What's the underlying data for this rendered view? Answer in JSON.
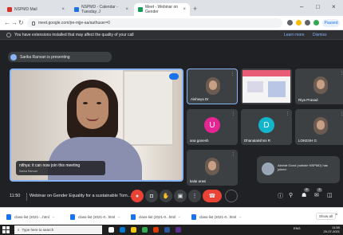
{
  "browser": {
    "tabs": [
      {
        "label": "NSPMD Mail",
        "favicon_color": "#d93025"
      },
      {
        "label": "NSPMD - Calendar - Tuesday, J",
        "favicon_color": "#1a73e8"
      },
      {
        "label": "Meet - Webinar on Gender",
        "favicon_color": "#0f9d58"
      }
    ],
    "url": "meet.google.com/jre-mjje-aa/authuser=0",
    "paused_label": "Paused",
    "window_controls": {
      "minimize": "–",
      "maximize": "□",
      "close": "×"
    }
  },
  "meet": {
    "notice": {
      "text": "You have extensions installed that may affect the quality of your call",
      "learn_more": "Learn more",
      "dismiss": "Dismiss"
    },
    "presenting_text": "Sarika Ranvan is presenting",
    "main_video": {
      "caption": "nithya: it can now join this meeting",
      "caption_name": "Sarika Ranvan"
    },
    "tiles": [
      {
        "name": "Aishwya Dr",
        "kind": "photo"
      },
      {
        "name": "",
        "kind": "slide"
      },
      {
        "name": "Riya Prasad",
        "kind": "photo"
      },
      {
        "name": "ana ganesh",
        "kind": "avatar",
        "initial": "U",
        "color": "#e52592"
      },
      {
        "name": "Dhanalakshmi R",
        "kind": "avatar",
        "initial": "D",
        "color": "#12b5cb"
      },
      {
        "name": "LOKESH G",
        "kind": "photo"
      },
      {
        "name": "kalai arasi",
        "kind": "photo"
      }
    ],
    "join_notice": "Akshat Gond (outside NSPMD) has joined",
    "controls": {
      "time": "11:50",
      "title": "Webinar on Gender Equality for a sustainable Tom...",
      "participants_badge": "8",
      "chat_badge": "3"
    }
  },
  "downloads": {
    "items": [
      {
        "label": "class-list (2021-...html"
      },
      {
        "label": "class-list (2021-0...html"
      },
      {
        "label": "class-list (2021-0...html"
      },
      {
        "label": "class-list (2021-0...html"
      }
    ],
    "show_all": "Show all"
  },
  "taskbar": {
    "search_placeholder": "Type here to search",
    "tray": "ENG",
    "time": "11:50",
    "date": "20-07-2021"
  }
}
